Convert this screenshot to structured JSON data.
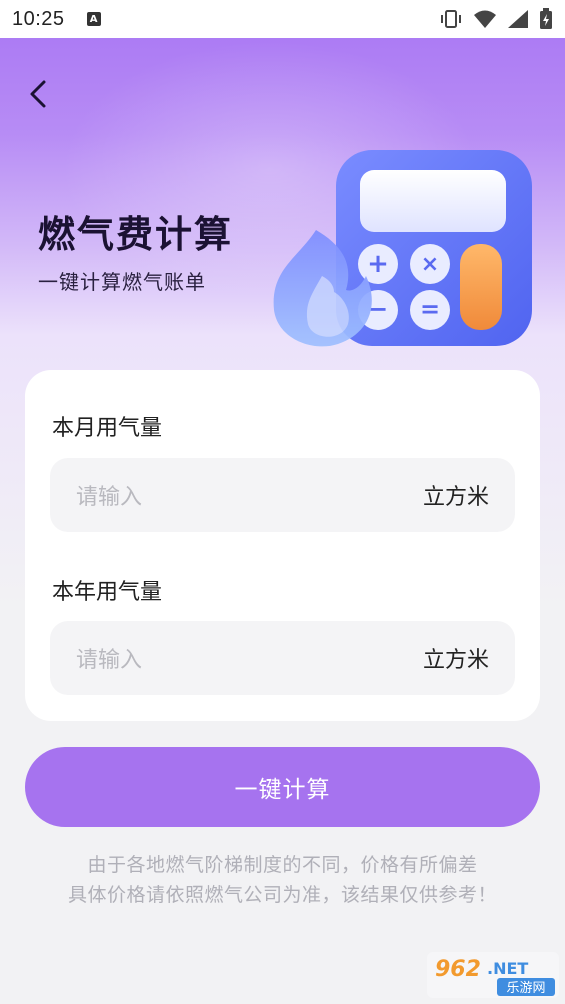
{
  "status_bar": {
    "time": "10:25",
    "badge": "A",
    "icons": [
      "vibrate-icon",
      "wifi-icon",
      "signal-icon",
      "battery-icon"
    ]
  },
  "header": {
    "back_icon": "chevron-left-icon",
    "title": "燃气费计算",
    "subtitle": "一键计算燃气账单",
    "illustration_icons": [
      "calculator-icon",
      "flame-icon"
    ]
  },
  "form": {
    "monthly": {
      "label": "本月用气量",
      "placeholder": "请输入",
      "unit": "立方米"
    },
    "yearly": {
      "label": "本年用气量",
      "placeholder": "请输入",
      "unit": "立方米"
    }
  },
  "action": {
    "calculate_label": "一键计算"
  },
  "notes": {
    "line1": "由于各地燃气阶梯制度的不同，价格有所偏差",
    "line2": "具体价格请依照燃气公司为准，该结果仅供参考！"
  },
  "watermark": {
    "brand": "962.NET",
    "site": "乐游网"
  },
  "colors": {
    "accent": "#a673ef",
    "title": "#1b1233",
    "placeholder": "#b9b9bf",
    "note": "#b0b0b8"
  }
}
